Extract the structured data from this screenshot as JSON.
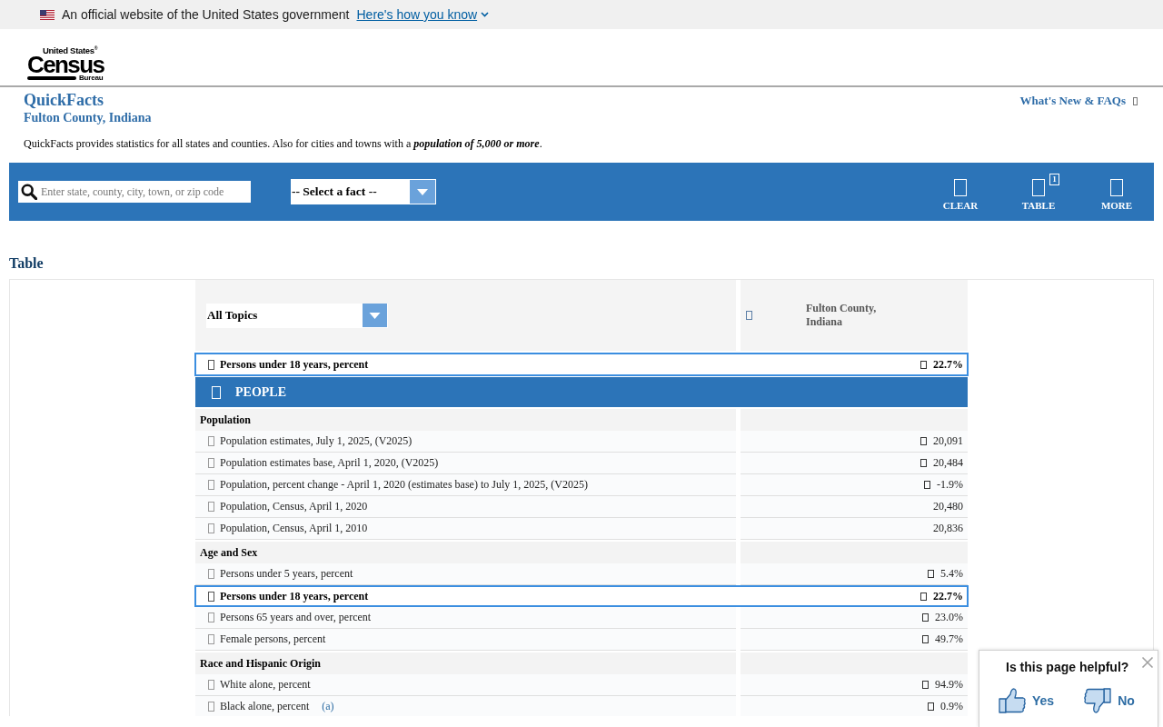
{
  "gov_banner": {
    "text": "An official website of the United States government",
    "link": "Here's how you know"
  },
  "logo": {
    "top": "United States$^{®}$",
    "main": "Census",
    "bottom": "Bureau"
  },
  "header": {
    "title": "QuickFacts",
    "subtitle": "Fulton County, Indiana",
    "link": "What's New & FAQs",
    "description": "QuickFacts provides statistics for all states and counties. Also for cities and towns with a **population of 5,000 or more**."
  },
  "toolbar": {
    "search": {
      "placeholder": "Enter state, county, city, town, or zip code"
    },
    "fact_select": {
      "value": "-- Select a fact --"
    },
    "buttons": [
      {
        "label": "CLEAR"
      },
      {
        "label": "TABLE",
        "badge": "1"
      },
      {
        "label": "MORE"
      }
    ]
  },
  "table_section": {
    "heading": "Table",
    "topic_select": {
      "value": "All Topics"
    },
    "column_heading": "Fulton County, Indiana",
    "pinned_row": {
      "label": "Persons under 18 years, percent",
      "value": "22.7%",
      "value_icon": true,
      "selected": true
    },
    "category": "PEOPLE",
    "groups": [
      {
        "title": "Population",
        "rows": [
          {
            "label": "Population estimates, July 1, 2025, (V2025)",
            "value": "20,091",
            "value_icon": true,
            "selected": false
          },
          {
            "label": "Population estimates base, April 1, 2020, (V2025)",
            "value": "20,484",
            "value_icon": true,
            "selected": false
          },
          {
            "label": "Population, percent change - April 1, 2020 (estimates base) to July 1, 2025, (V2025)",
            "value": "-1.9%",
            "value_icon": true,
            "selected": false
          },
          {
            "label": "Population, Census, April 1, 2020",
            "value": "20,480",
            "value_icon": false,
            "selected": false
          },
          {
            "label": "Population, Census, April 1, 2010",
            "value": "20,836",
            "value_icon": false,
            "selected": false
          }
        ]
      },
      {
        "title": "Age and Sex",
        "rows": [
          {
            "label": "Persons under 5 years, percent",
            "value": "5.4%",
            "value_icon": true,
            "selected": false
          },
          {
            "label": "Persons under 18 years, percent",
            "value": "22.7%",
            "value_icon": true,
            "selected": true
          },
          {
            "label": "Persons 65 years and over, percent",
            "value": "23.0%",
            "value_icon": true,
            "selected": false
          },
          {
            "label": "Female persons, percent",
            "value": "49.7%",
            "value_icon": true,
            "selected": false
          }
        ]
      },
      {
        "title": "Race and Hispanic Origin",
        "rows": [
          {
            "label": "White alone, percent",
            "value": "94.9%",
            "value_icon": true,
            "selected": false
          },
          {
            "label": "Black alone, percent",
            "note": "(a)",
            "value": "0.9%",
            "value_icon": true,
            "selected": false
          }
        ]
      }
    ]
  },
  "feedback": {
    "question": "Is this page helpful?",
    "yes": "Yes",
    "no": "No"
  }
}
